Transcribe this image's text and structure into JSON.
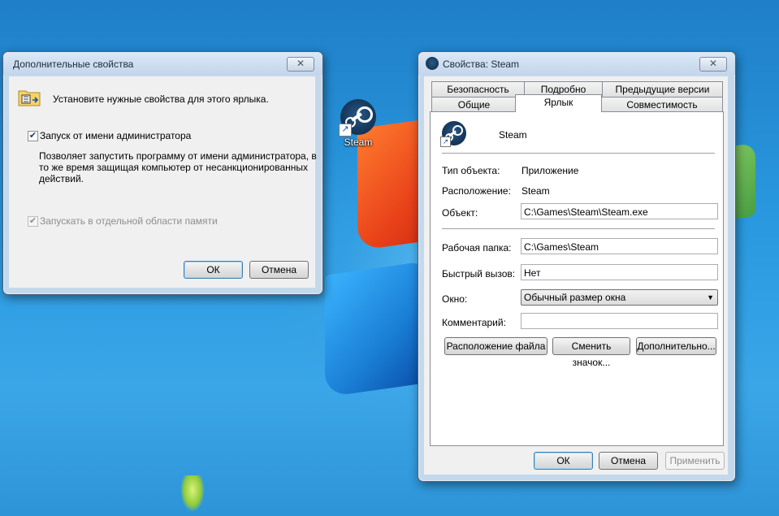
{
  "desktop": {
    "icon_label": "Steam"
  },
  "advanced_dialog": {
    "title": "Дополнительные свойства",
    "header_text": "Установите нужные свойства для этого ярлыка.",
    "run_as_admin_label": "Запуск от имени администратора",
    "run_as_admin_checked": true,
    "description_line1": "Позволяет запустить программу от имени администратора, в",
    "description_line2": "то же время защищая компьютер от несанкционированных",
    "description_line3": "действий.",
    "separate_memory_label": "Запускать в отдельной области памяти",
    "separate_memory_checked": true,
    "ok_label": "ОК",
    "cancel_label": "Отмена",
    "close_glyph": "✕"
  },
  "props_dialog": {
    "title": "Свойства: Steam",
    "close_glyph": "✕",
    "tabs_row1": [
      "Безопасность",
      "Подробно",
      "Предыдущие версии"
    ],
    "tabs_row2": [
      "Общие",
      "Ярлык",
      "Совместимость"
    ],
    "active_tab": "Ярлык",
    "app_name": "Steam",
    "object_type_label": "Тип объекта:",
    "object_type_value": "Приложение",
    "location_label": "Расположение:",
    "location_value": "Steam",
    "target_label": "Объект:",
    "target_value": "C:\\Games\\Steam\\Steam.exe",
    "workdir_label": "Рабочая папка:",
    "workdir_value": "C:\\Games\\Steam",
    "hotkey_label": "Быстрый вызов:",
    "hotkey_value": "Нет",
    "window_label": "Окно:",
    "window_value": "Обычный размер окна",
    "comment_label": "Комментарий:",
    "comment_value": "",
    "open_location_label": "Расположение файла",
    "change_icon_label": "Сменить значок...",
    "advanced_label": "Дополнительно...",
    "ok_label": "ОК",
    "cancel_label": "Отмена",
    "apply_label": "Применить"
  }
}
